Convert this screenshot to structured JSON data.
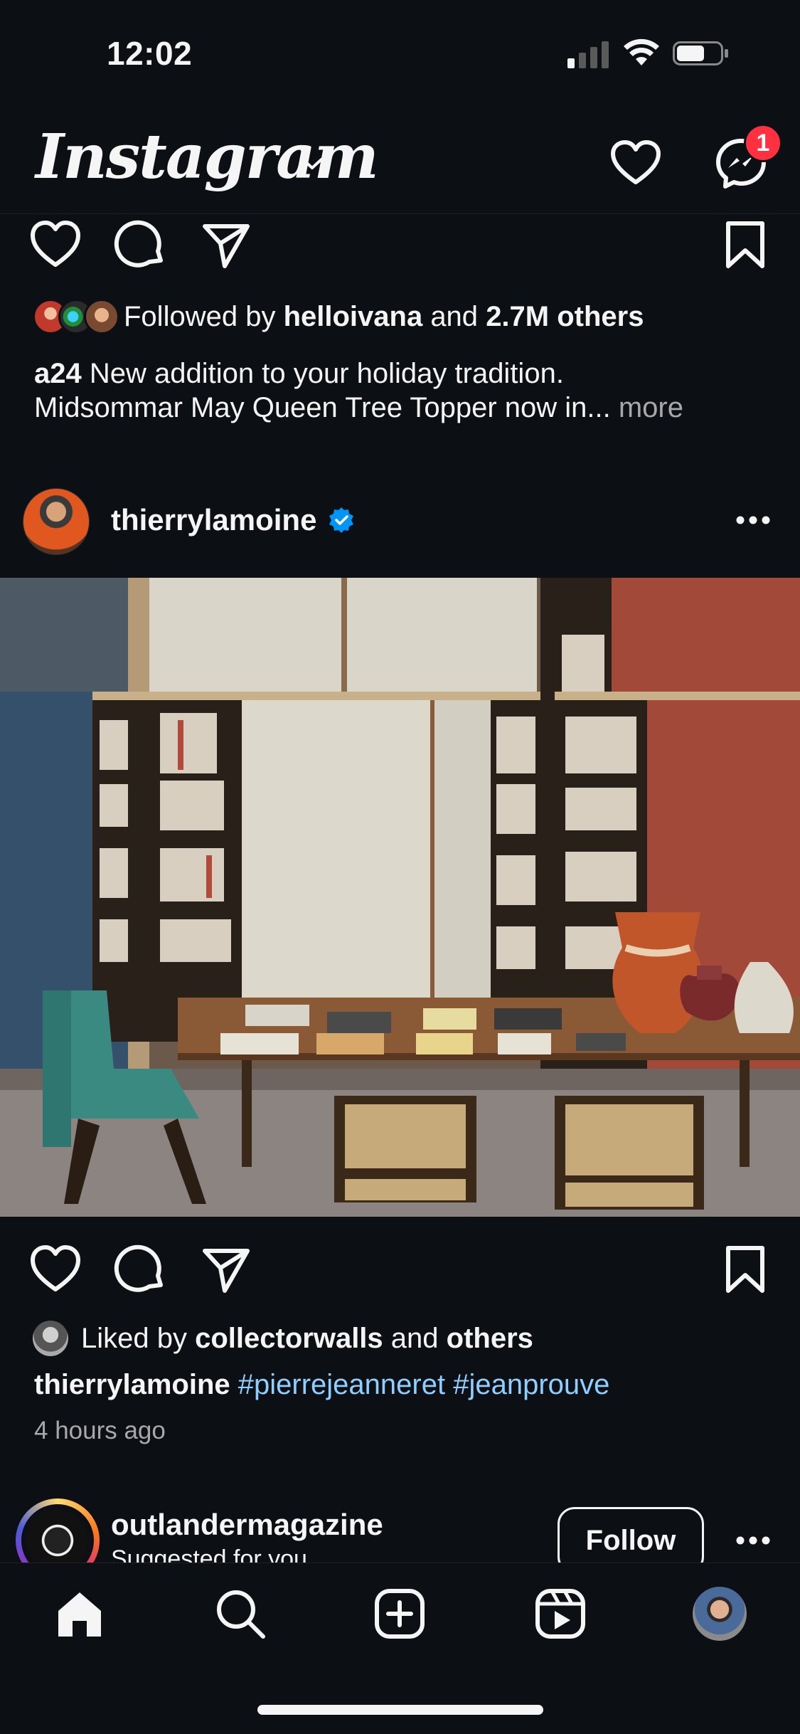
{
  "status_bar": {
    "time": "12:02"
  },
  "header": {
    "logo_text": "Instagram",
    "notification_count": "1"
  },
  "post1": {
    "followed_prefix": "Followed by",
    "followed_user": "helloivana",
    "followed_and": "and",
    "followed_others": "2.7M others",
    "caption_user": "a24",
    "caption_line1": "New addition to your holiday tradition.",
    "caption_line2": "Midsommar May Queen Tree Topper now in...",
    "more_label": "more"
  },
  "post2": {
    "username": "thierrylamoine",
    "liked_prefix": "Liked by",
    "liked_user": "collectorwalls",
    "liked_and": "and",
    "liked_others": "others",
    "caption_user": "thierrylamoine",
    "hashtag1": "#pierrejeanneret",
    "hashtag2": "#jeanprouve",
    "timestamp": "4 hours ago"
  },
  "post3": {
    "username": "outlandermagazine",
    "subtitle": "Suggested for you",
    "follow_label": "Follow"
  },
  "colors": {
    "background": "#0c1014",
    "badge": "#ff3040",
    "hashtag": "#8fcfff",
    "verified": "#0095f6"
  }
}
